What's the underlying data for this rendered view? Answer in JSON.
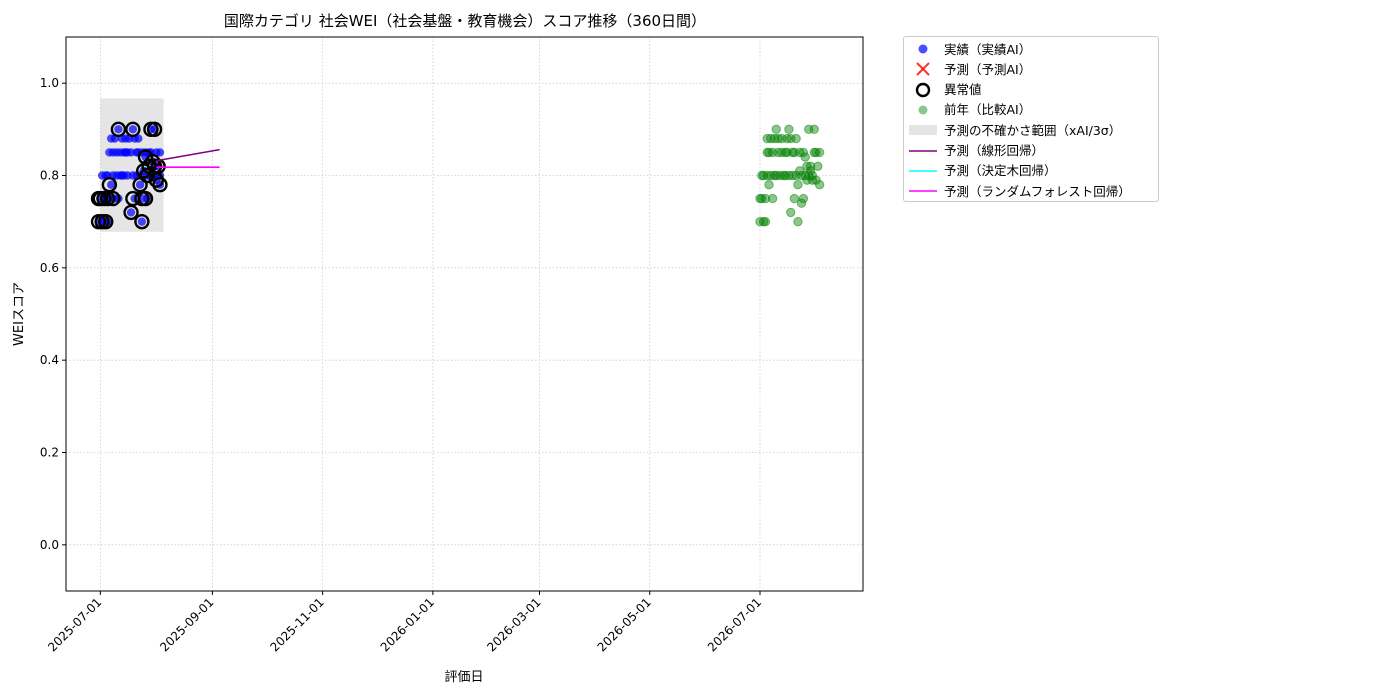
{
  "chart_data": {
    "type": "scatter",
    "title": "国際カテゴリ 社会WEI（社会基盤・教育機会）スコア推移（360日間）",
    "xlabel": "評価日",
    "ylabel": "WEIスコア",
    "ylim": [
      -0.1,
      1.1
    ],
    "yticks": [
      "0.0",
      "0.2",
      "0.4",
      "0.6",
      "0.8",
      "1.0"
    ],
    "xlim": [
      "2025-06-12",
      "2026-08-27"
    ],
    "xticks": [
      "2025-07-01",
      "2025-09-01",
      "2025-11-01",
      "2026-01-01",
      "2026-03-01",
      "2026-05-01",
      "2026-07-01"
    ],
    "grid": true,
    "legend_position": "outside-top-right",
    "colors": {
      "actual": "#0000ff",
      "forecast": "#ff0000",
      "anomaly": "#000000",
      "previous": "#008000",
      "band": "#d3d3d3",
      "linear": "#800080",
      "tree": "#00ffff",
      "forest": "#ff00ff"
    },
    "legend": [
      {
        "key": "actual",
        "label": "実績（実績AI）",
        "symbol": "dot"
      },
      {
        "key": "forecast",
        "label": "予測（予測AI）",
        "symbol": "x"
      },
      {
        "key": "anomaly",
        "label": "異常値",
        "symbol": "ring"
      },
      {
        "key": "previous",
        "label": "前年（比較AI）",
        "symbol": "dot-faded"
      },
      {
        "key": "band",
        "label": "予測の不確かさ範囲（xAI/3σ）",
        "symbol": "rect"
      },
      {
        "key": "linear",
        "label": "予測（線形回帰）",
        "symbol": "line"
      },
      {
        "key": "tree",
        "label": "予測（決定木回帰）",
        "symbol": "line"
      },
      {
        "key": "forest",
        "label": "予測（ランダムフォレスト回帰）",
        "symbol": "line"
      }
    ],
    "series": [
      {
        "name": "実績（実績AI）",
        "key": "actual",
        "points": [
          [
            "2025-07-01",
            0.7
          ],
          [
            "2025-07-02",
            0.75
          ],
          [
            "2025-07-02",
            0.8
          ],
          [
            "2025-07-03",
            0.7
          ],
          [
            "2025-07-03",
            0.75
          ],
          [
            "2025-07-04",
            0.8
          ],
          [
            "2025-07-04",
            0.75
          ],
          [
            "2025-07-05",
            0.7
          ],
          [
            "2025-07-05",
            0.8
          ],
          [
            "2025-07-06",
            0.85
          ],
          [
            "2025-07-06",
            0.75
          ],
          [
            "2025-07-07",
            0.78
          ],
          [
            "2025-07-07",
            0.88
          ],
          [
            "2025-07-08",
            0.8
          ],
          [
            "2025-07-08",
            0.85
          ],
          [
            "2025-07-09",
            0.75
          ],
          [
            "2025-07-09",
            0.88
          ],
          [
            "2025-07-10",
            0.8
          ],
          [
            "2025-07-10",
            0.85
          ],
          [
            "2025-07-11",
            0.9
          ],
          [
            "2025-07-11",
            0.75
          ],
          [
            "2025-07-12",
            0.8
          ],
          [
            "2025-07-12",
            0.85
          ],
          [
            "2025-07-13",
            0.88
          ],
          [
            "2025-07-13",
            0.8
          ],
          [
            "2025-07-14",
            0.85
          ],
          [
            "2025-07-14",
            0.8
          ],
          [
            "2025-07-15",
            0.88
          ],
          [
            "2025-07-15",
            0.85
          ],
          [
            "2025-07-16",
            0.8
          ],
          [
            "2025-07-16",
            0.85
          ],
          [
            "2025-07-17",
            0.88
          ],
          [
            "2025-07-18",
            0.72
          ],
          [
            "2025-07-18",
            0.85
          ],
          [
            "2025-07-19",
            0.9
          ],
          [
            "2025-07-19",
            0.8
          ],
          [
            "2025-07-20",
            0.75
          ],
          [
            "2025-07-20",
            0.88
          ],
          [
            "2025-07-21",
            0.85
          ],
          [
            "2025-07-21",
            0.8
          ],
          [
            "2025-07-22",
            0.88
          ],
          [
            "2025-07-22",
            0.85
          ],
          [
            "2025-07-23",
            0.78
          ],
          [
            "2025-07-23",
            0.8
          ],
          [
            "2025-07-24",
            0.7
          ],
          [
            "2025-07-24",
            0.85
          ],
          [
            "2025-07-25",
            0.81
          ],
          [
            "2025-07-25",
            0.75
          ],
          [
            "2025-07-26",
            0.84
          ],
          [
            "2025-07-26",
            0.85
          ],
          [
            "2025-07-27",
            0.75
          ],
          [
            "2025-07-27",
            0.8
          ],
          [
            "2025-07-28",
            0.85
          ],
          [
            "2025-07-28",
            0.8
          ],
          [
            "2025-07-29",
            0.9
          ],
          [
            "2025-07-29",
            0.85
          ],
          [
            "2025-07-30",
            0.8
          ],
          [
            "2025-07-30",
            0.83
          ],
          [
            "2025-07-31",
            0.9
          ],
          [
            "2025-07-31",
            0.82
          ],
          [
            "2025-08-01",
            0.79
          ],
          [
            "2025-08-01",
            0.85
          ],
          [
            "2025-08-02",
            0.82
          ],
          [
            "2025-08-02",
            0.8
          ],
          [
            "2025-08-03",
            0.78
          ],
          [
            "2025-08-03",
            0.85
          ],
          [
            "2025-08-03",
            0.8
          ]
        ]
      },
      {
        "name": "異常値",
        "key": "anomaly",
        "points": [
          [
            "2025-06-30",
            0.75
          ],
          [
            "2025-06-30",
            0.7
          ],
          [
            "2025-07-01",
            0.75
          ],
          [
            "2025-07-02",
            0.7
          ],
          [
            "2025-07-03",
            0.75
          ],
          [
            "2025-07-04",
            0.7
          ],
          [
            "2025-07-05",
            0.75
          ],
          [
            "2025-07-06",
            0.78
          ],
          [
            "2025-07-08",
            0.75
          ],
          [
            "2025-07-11",
            0.9
          ],
          [
            "2025-07-18",
            0.72
          ],
          [
            "2025-07-19",
            0.9
          ],
          [
            "2025-07-19",
            0.75
          ],
          [
            "2025-07-23",
            0.78
          ],
          [
            "2025-07-24",
            0.75
          ],
          [
            "2025-07-24",
            0.7
          ],
          [
            "2025-07-25",
            0.81
          ],
          [
            "2025-07-26",
            0.84
          ],
          [
            "2025-07-26",
            0.75
          ],
          [
            "2025-07-27",
            0.8
          ],
          [
            "2025-07-28",
            0.82
          ],
          [
            "2025-07-29",
            0.9
          ],
          [
            "2025-07-30",
            0.83
          ],
          [
            "2025-07-31",
            0.9
          ],
          [
            "2025-07-31",
            0.82
          ],
          [
            "2025-08-01",
            0.79
          ],
          [
            "2025-08-02",
            0.82
          ],
          [
            "2025-08-03",
            0.78
          ]
        ]
      },
      {
        "name": "前年（比較AI）",
        "key": "previous",
        "points": [
          [
            "2026-07-01",
            0.75
          ],
          [
            "2026-07-01",
            0.7
          ],
          [
            "2026-07-02",
            0.8
          ],
          [
            "2026-07-02",
            0.75
          ],
          [
            "2026-07-03",
            0.7
          ],
          [
            "2026-07-03",
            0.8
          ],
          [
            "2026-07-04",
            0.75
          ],
          [
            "2026-07-04",
            0.7
          ],
          [
            "2026-07-05",
            0.88
          ],
          [
            "2026-07-05",
            0.8
          ],
          [
            "2026-07-05",
            0.85
          ],
          [
            "2026-07-06",
            0.78
          ],
          [
            "2026-07-06",
            0.85
          ],
          [
            "2026-07-07",
            0.8
          ],
          [
            "2026-07-07",
            0.88
          ],
          [
            "2026-07-08",
            0.75
          ],
          [
            "2026-07-08",
            0.85
          ],
          [
            "2026-07-09",
            0.8
          ],
          [
            "2026-07-09",
            0.88
          ],
          [
            "2026-07-10",
            0.9
          ],
          [
            "2026-07-10",
            0.8
          ],
          [
            "2026-07-11",
            0.85
          ],
          [
            "2026-07-11",
            0.88
          ],
          [
            "2026-07-12",
            0.8
          ],
          [
            "2026-07-13",
            0.85
          ],
          [
            "2026-07-13",
            0.88
          ],
          [
            "2026-07-14",
            0.8
          ],
          [
            "2026-07-15",
            0.85
          ],
          [
            "2026-07-15",
            0.8
          ],
          [
            "2026-07-16",
            0.88
          ],
          [
            "2026-07-16",
            0.85
          ],
          [
            "2026-07-17",
            0.9
          ],
          [
            "2026-07-17",
            0.8
          ],
          [
            "2026-07-18",
            0.72
          ],
          [
            "2026-07-18",
            0.88
          ],
          [
            "2026-07-19",
            0.85
          ],
          [
            "2026-07-19",
            0.8
          ],
          [
            "2026-07-20",
            0.75
          ],
          [
            "2026-07-20",
            0.85
          ],
          [
            "2026-07-21",
            0.88
          ],
          [
            "2026-07-21",
            0.8
          ],
          [
            "2026-07-22",
            0.7
          ],
          [
            "2026-07-22",
            0.78
          ],
          [
            "2026-07-23",
            0.81
          ],
          [
            "2026-07-23",
            0.85
          ],
          [
            "2026-07-24",
            0.74
          ],
          [
            "2026-07-24",
            0.8
          ],
          [
            "2026-07-25",
            0.75
          ],
          [
            "2026-07-25",
            0.85
          ],
          [
            "2026-07-26",
            0.84
          ],
          [
            "2026-07-26",
            0.8
          ],
          [
            "2026-07-27",
            0.82
          ],
          [
            "2026-07-27",
            0.79
          ],
          [
            "2026-07-28",
            0.9
          ],
          [
            "2026-07-28",
            0.8
          ],
          [
            "2026-07-29",
            0.82
          ],
          [
            "2026-07-29",
            0.81
          ],
          [
            "2026-07-30",
            0.8
          ],
          [
            "2026-07-30",
            0.79
          ],
          [
            "2026-07-31",
            0.9
          ],
          [
            "2026-07-31",
            0.85
          ],
          [
            "2026-08-01",
            0.85
          ],
          [
            "2026-08-01",
            0.79
          ],
          [
            "2026-08-02",
            0.82
          ],
          [
            "2026-08-03",
            0.78
          ],
          [
            "2026-08-03",
            0.85
          ]
        ]
      }
    ],
    "band": {
      "x0": "2025-07-01",
      "x1": "2025-08-05",
      "y0": 0.678,
      "y1": 0.967
    },
    "lines": [
      {
        "name": "予測（線形回帰）",
        "key": "linear",
        "points": [
          [
            "2025-08-01",
            0.832
          ],
          [
            "2025-09-05",
            0.856
          ]
        ]
      },
      {
        "name": "予測（ランダムフォレスト回帰）",
        "key": "forest",
        "points": [
          [
            "2025-08-01",
            0.818
          ],
          [
            "2025-09-05",
            0.818
          ]
        ]
      }
    ]
  }
}
